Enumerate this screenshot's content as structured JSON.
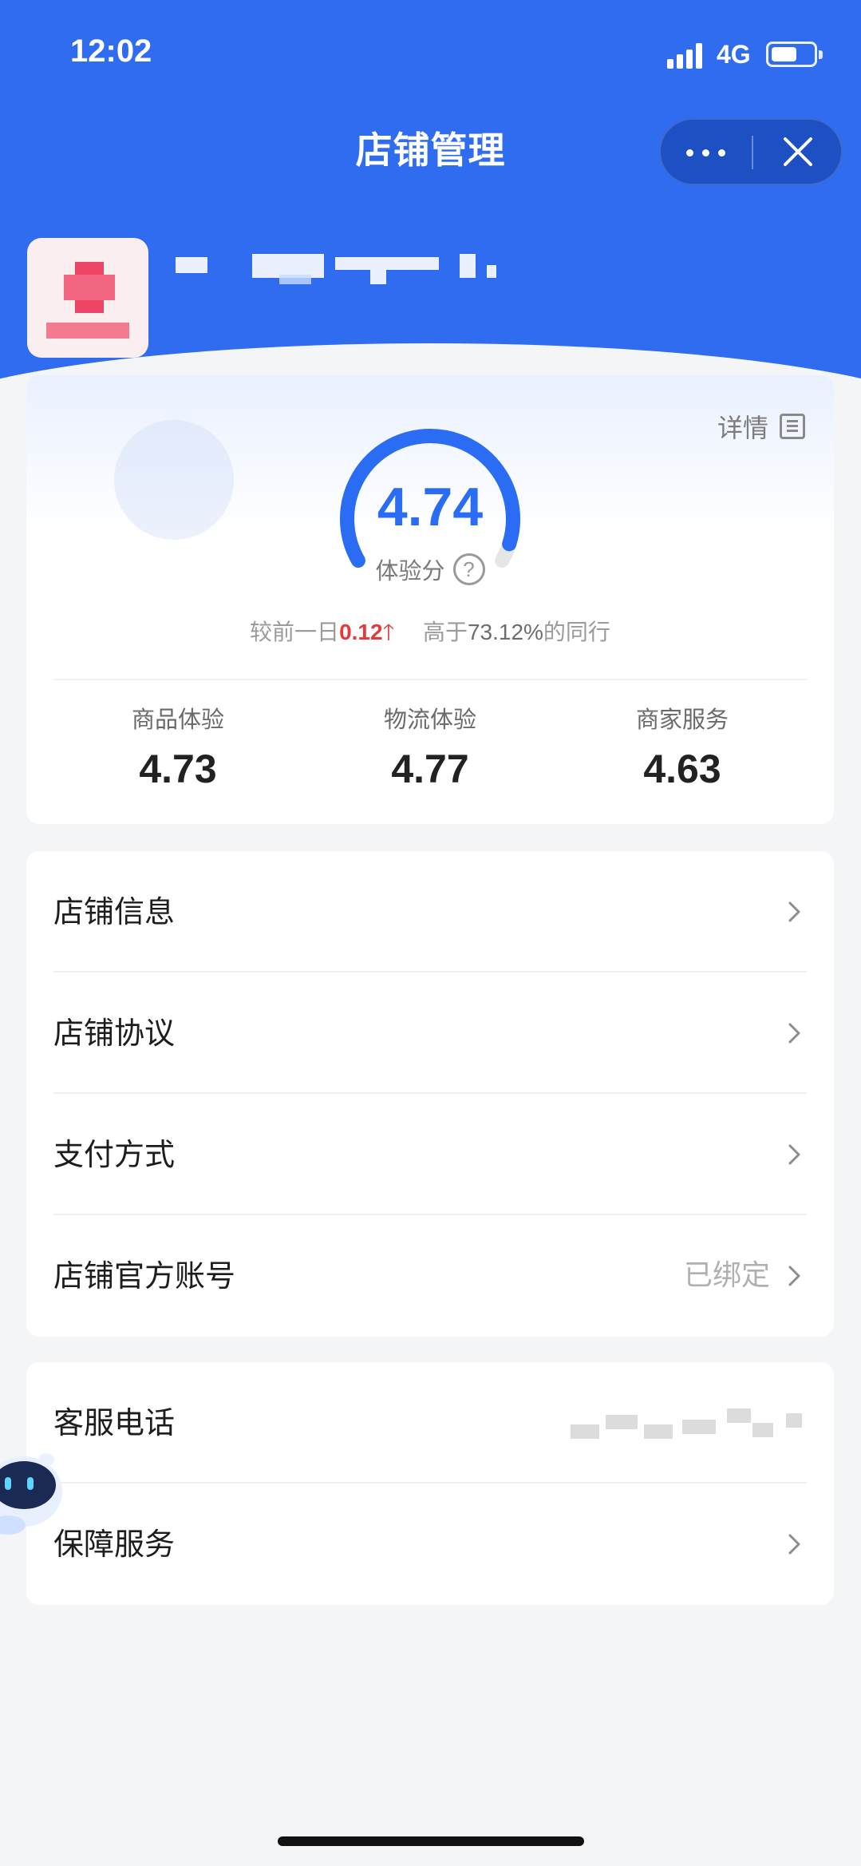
{
  "status_bar": {
    "time": "12:02",
    "network": "4G",
    "battery_level": 0.6
  },
  "header": {
    "title": "店铺管理"
  },
  "score_card": {
    "detail_label": "详情",
    "score": "4.74",
    "score_level": 0.948,
    "score_label": "体验分",
    "help_symbol": "?",
    "trend_prefix": "较前一日",
    "trend_delta": "0.12",
    "trend_arrow": "🡑",
    "trend_mid": "高于",
    "trend_percent": "73.12%",
    "trend_suffix": "的同行",
    "metrics": [
      {
        "label": "商品体验",
        "value": "4.73"
      },
      {
        "label": "物流体验",
        "value": "4.77"
      },
      {
        "label": "商家服务",
        "value": "4.63"
      }
    ]
  },
  "menu_group_1": [
    {
      "label": "店铺信息",
      "value": ""
    },
    {
      "label": "店铺协议",
      "value": ""
    },
    {
      "label": "支付方式",
      "value": ""
    },
    {
      "label": "店铺官方账号",
      "value": "已绑定"
    }
  ],
  "menu_group_2": [
    {
      "label": "客服电话"
    },
    {
      "label": "保障服务"
    }
  ],
  "colors": {
    "brand_blue": "#2f6cf0",
    "score_blue": "#2a6df4",
    "trend_red": "#e23b3b",
    "background": "#f4f5f7"
  },
  "icons": [
    "more-dots-icon",
    "close-icon",
    "document-icon",
    "help-icon",
    "chevron-right-icon",
    "robot-assistant-icon"
  ]
}
